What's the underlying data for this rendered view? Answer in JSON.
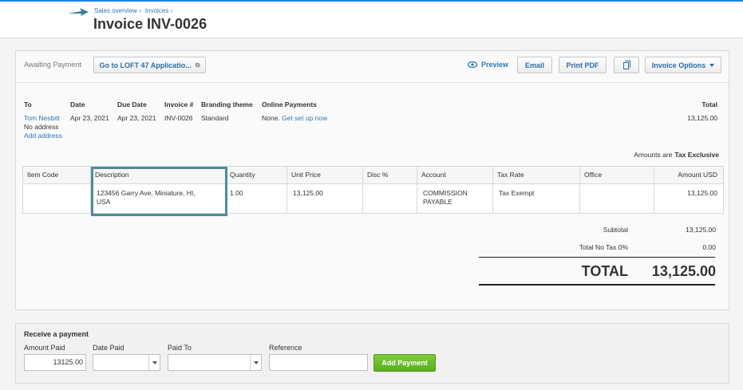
{
  "header": {
    "breadcrumbs": [
      "Sales overview ›",
      "Invoices ›"
    ],
    "title": "Invoice INV-0026"
  },
  "toolbar": {
    "status": "Awaiting Payment",
    "goto_label": "Go to LOFT 47 Applicatio...",
    "preview_label": "Preview",
    "email_label": "Email",
    "print_pdf_label": "Print PDF",
    "copy_icon": "copy-icon",
    "options_label": "Invoice Options"
  },
  "details": {
    "to_label": "To",
    "to_name": "Tom Nesbitt",
    "to_address": "No address",
    "add_address": "Add address",
    "date_label": "Date",
    "date": "Apr 23, 2021",
    "due_date_label": "Due Date",
    "due_date": "Apr 23, 2021",
    "invoice_no_label": "Invoice #",
    "invoice_no": "INV-0026",
    "branding_label": "Branding theme",
    "branding": "Standard",
    "online_payments_label": "Online Payments",
    "online_payments": "None.",
    "online_payments_link": "Get set up now",
    "total_label": "Total",
    "total": "13,125.00"
  },
  "amounts_are": {
    "label": "Amounts are",
    "value": "Tax Exclusive"
  },
  "line_items": {
    "columns": [
      "Item Code",
      "Description",
      "Quantity",
      "Unit Price",
      "Disc %",
      "Account",
      "Tax Rate",
      "Office",
      "Amount USD"
    ],
    "rows": [
      {
        "item_code": "",
        "description_1": "123456 Garry Ave, Miniature, HI,",
        "description_2": "USA",
        "quantity": "1.00",
        "unit_price": "13,125.00",
        "disc": "",
        "account_1": "COMMISSION",
        "account_2": "PAYABLE",
        "tax_rate": "Tax Exempt",
        "office": "",
        "amount": "13,125.00"
      }
    ]
  },
  "totals": {
    "subtotal_label": "Subtotal",
    "subtotal": "13,125.00",
    "tax_label": "Total No Tax 0%",
    "tax": "0.00",
    "total_label": "TOTAL",
    "total": "13,125.00"
  },
  "payment": {
    "title": "Receive a payment",
    "amount_paid_label": "Amount Paid",
    "amount_paid": "13125.00",
    "date_paid_label": "Date Paid",
    "paid_to_label": "Paid To",
    "reference_label": "Reference",
    "add_payment_label": "Add Payment"
  },
  "colors": {
    "accent": "#2a7ab5",
    "highlight_box": "#4d8c9c",
    "add_payment": "#5aae1f"
  }
}
